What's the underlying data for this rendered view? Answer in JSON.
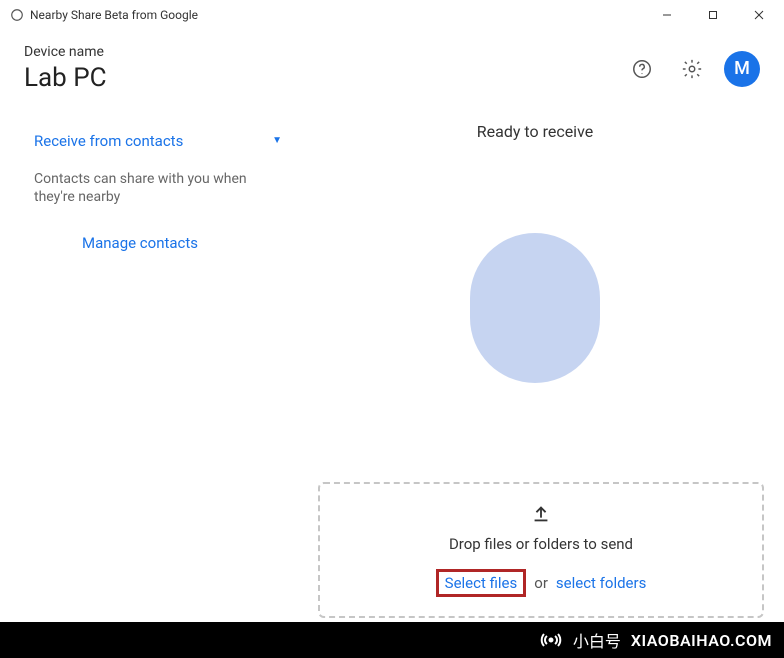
{
  "window": {
    "title": "Nearby Share Beta from Google"
  },
  "header": {
    "device_label": "Device name",
    "device_name": "Lab PC",
    "avatar_initial": "M"
  },
  "sidebar": {
    "visibility_label": "Receive from contacts",
    "contact_description": "Contacts can share with you when they're nearby",
    "manage_contacts": "Manage contacts"
  },
  "content": {
    "status": "Ready to receive"
  },
  "drop": {
    "instruction": "Drop files or folders to send",
    "select_files": "Select files",
    "or": "or",
    "select_folders": "select folders"
  },
  "watermark": {
    "cn_text": "小白号",
    "url": "XIAOBAIHAO.COM"
  }
}
